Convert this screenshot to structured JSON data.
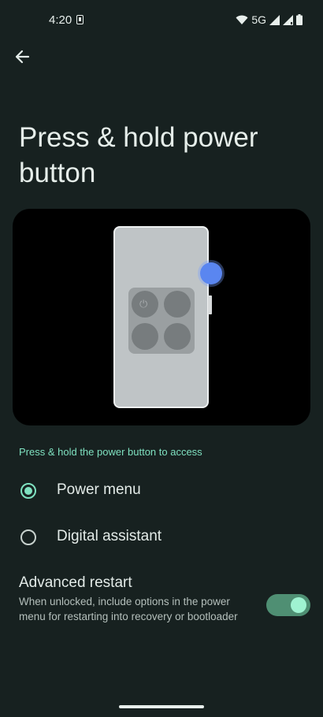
{
  "status_bar": {
    "time": "4:20",
    "network": "5G",
    "icons": [
      "sim-card-icon",
      "wifi-icon",
      "signal-icon",
      "signal-icon",
      "battery-icon"
    ]
  },
  "app_bar": {
    "back_icon": "arrow-back-icon"
  },
  "page": {
    "title": "Press & hold power button"
  },
  "illustration": {
    "description_icons": [
      "phone-illustration",
      "power-icon"
    ],
    "accent_color": "#5a86f0"
  },
  "section": {
    "header": "Press & hold the power button to access"
  },
  "options": [
    {
      "label": "Power menu",
      "selected": true
    },
    {
      "label": "Digital assistant",
      "selected": false
    }
  ],
  "advanced_restart": {
    "title": "Advanced restart",
    "summary": "When unlocked, include options in the power menu for restarting into recovery or bootloader",
    "enabled": true
  },
  "colors": {
    "background": "#172120",
    "accent": "#7fe1c0",
    "toggle_track": "#4f8f73"
  }
}
